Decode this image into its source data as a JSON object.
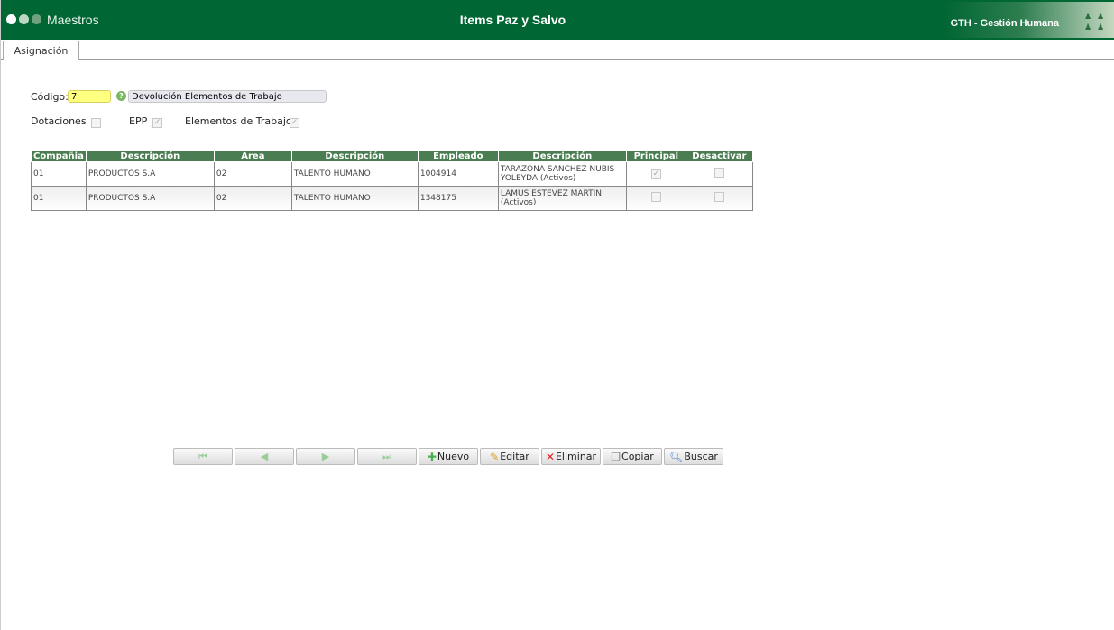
{
  "header": {
    "app": "Maestros",
    "title": "Items Paz y Salvo",
    "brand": "GTH - Gestión Humana"
  },
  "tabs": [
    {
      "label": "Asignación",
      "active": true
    }
  ],
  "form": {
    "codigo_label": "Código:",
    "codigo_value": "7",
    "descripcion_value": "Devolución Elementos de Trabajo",
    "checks": [
      {
        "label": "Dotaciones",
        "checked": false
      },
      {
        "label": "EPP",
        "checked": true
      },
      {
        "label": "Elementos de Trabajo",
        "checked": true
      }
    ]
  },
  "table": {
    "headers": [
      "Compañia",
      "Descripción",
      "Área",
      "Descripción",
      "Empleado",
      "Descripción",
      "Principal",
      "Desactivar"
    ],
    "rows": [
      {
        "compania": "01",
        "desc": "PRODUCTOS S.A",
        "area": "02",
        "area_desc": "TALENTO HUMANO",
        "empleado": "1004914",
        "emp_desc": "TARAZONA SANCHEZ NUBIS YOLEYDA (Activos)",
        "principal": true,
        "desactivar": false
      },
      {
        "compania": "01",
        "desc": "PRODUCTOS S.A",
        "area": "02",
        "area_desc": "TALENTO HUMANO",
        "empleado": "1348175",
        "emp_desc": "LAMUS ESTEVEZ MARTIN (Activos)",
        "principal": false,
        "desactivar": false
      }
    ]
  },
  "toolbar": {
    "nuevo": "Nuevo",
    "editar": "Editar",
    "eliminar": "Eliminar",
    "copiar": "Copiar",
    "buscar": "Buscar"
  },
  "colors": {
    "header": "#006633",
    "table_header": "#4a7d51",
    "codigo_bg": "#ffff80"
  }
}
